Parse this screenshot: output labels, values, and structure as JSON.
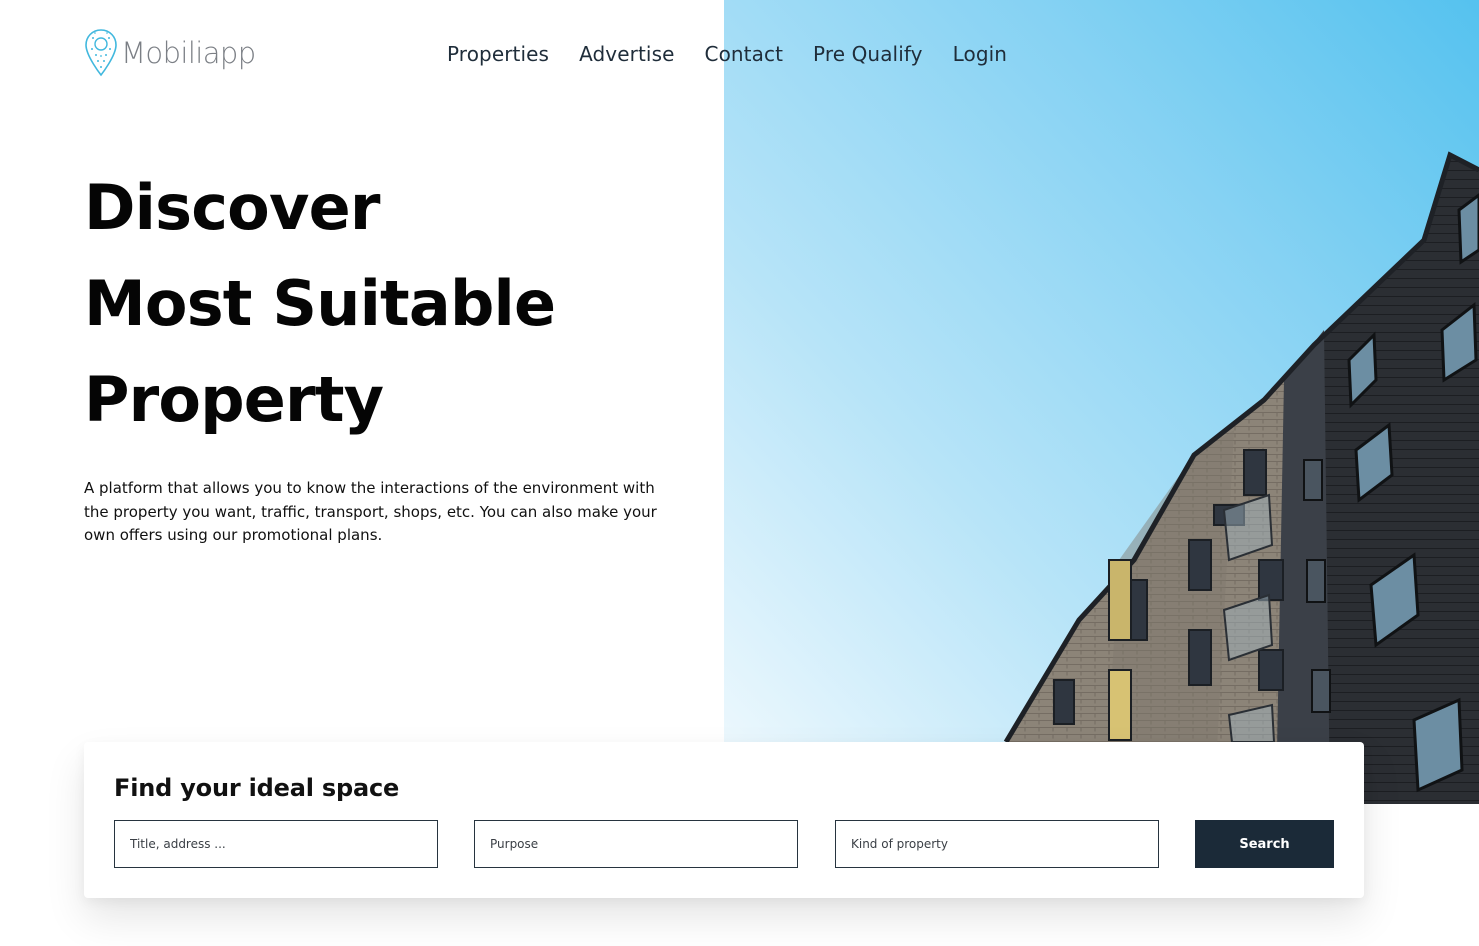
{
  "brand": {
    "name": "Mobiliapp"
  },
  "nav": {
    "items": [
      {
        "label": "Properties"
      },
      {
        "label": "Advertise"
      },
      {
        "label": "Contact"
      },
      {
        "label": "Pre Qualify"
      },
      {
        "label": "Login"
      }
    ]
  },
  "hero": {
    "headline_lines": [
      "Discover",
      "Most Suitable",
      "Property"
    ],
    "description": "A platform that allows you to know the interactions of the environment with the property you want, traffic, transport, shops, etc. You can also make your own offers using our promotional plans."
  },
  "search": {
    "title": "Find your ideal space",
    "fields": [
      {
        "placeholder": "Title, address ..."
      },
      {
        "placeholder": "Purpose"
      },
      {
        "placeholder": "Kind of property"
      }
    ],
    "button_label": "Search"
  },
  "colors": {
    "accent": "#1b2a38",
    "logo_icon": "#41b8de",
    "sky_top": "#5bc5f1",
    "sky_bottom": "#eef8fd"
  }
}
